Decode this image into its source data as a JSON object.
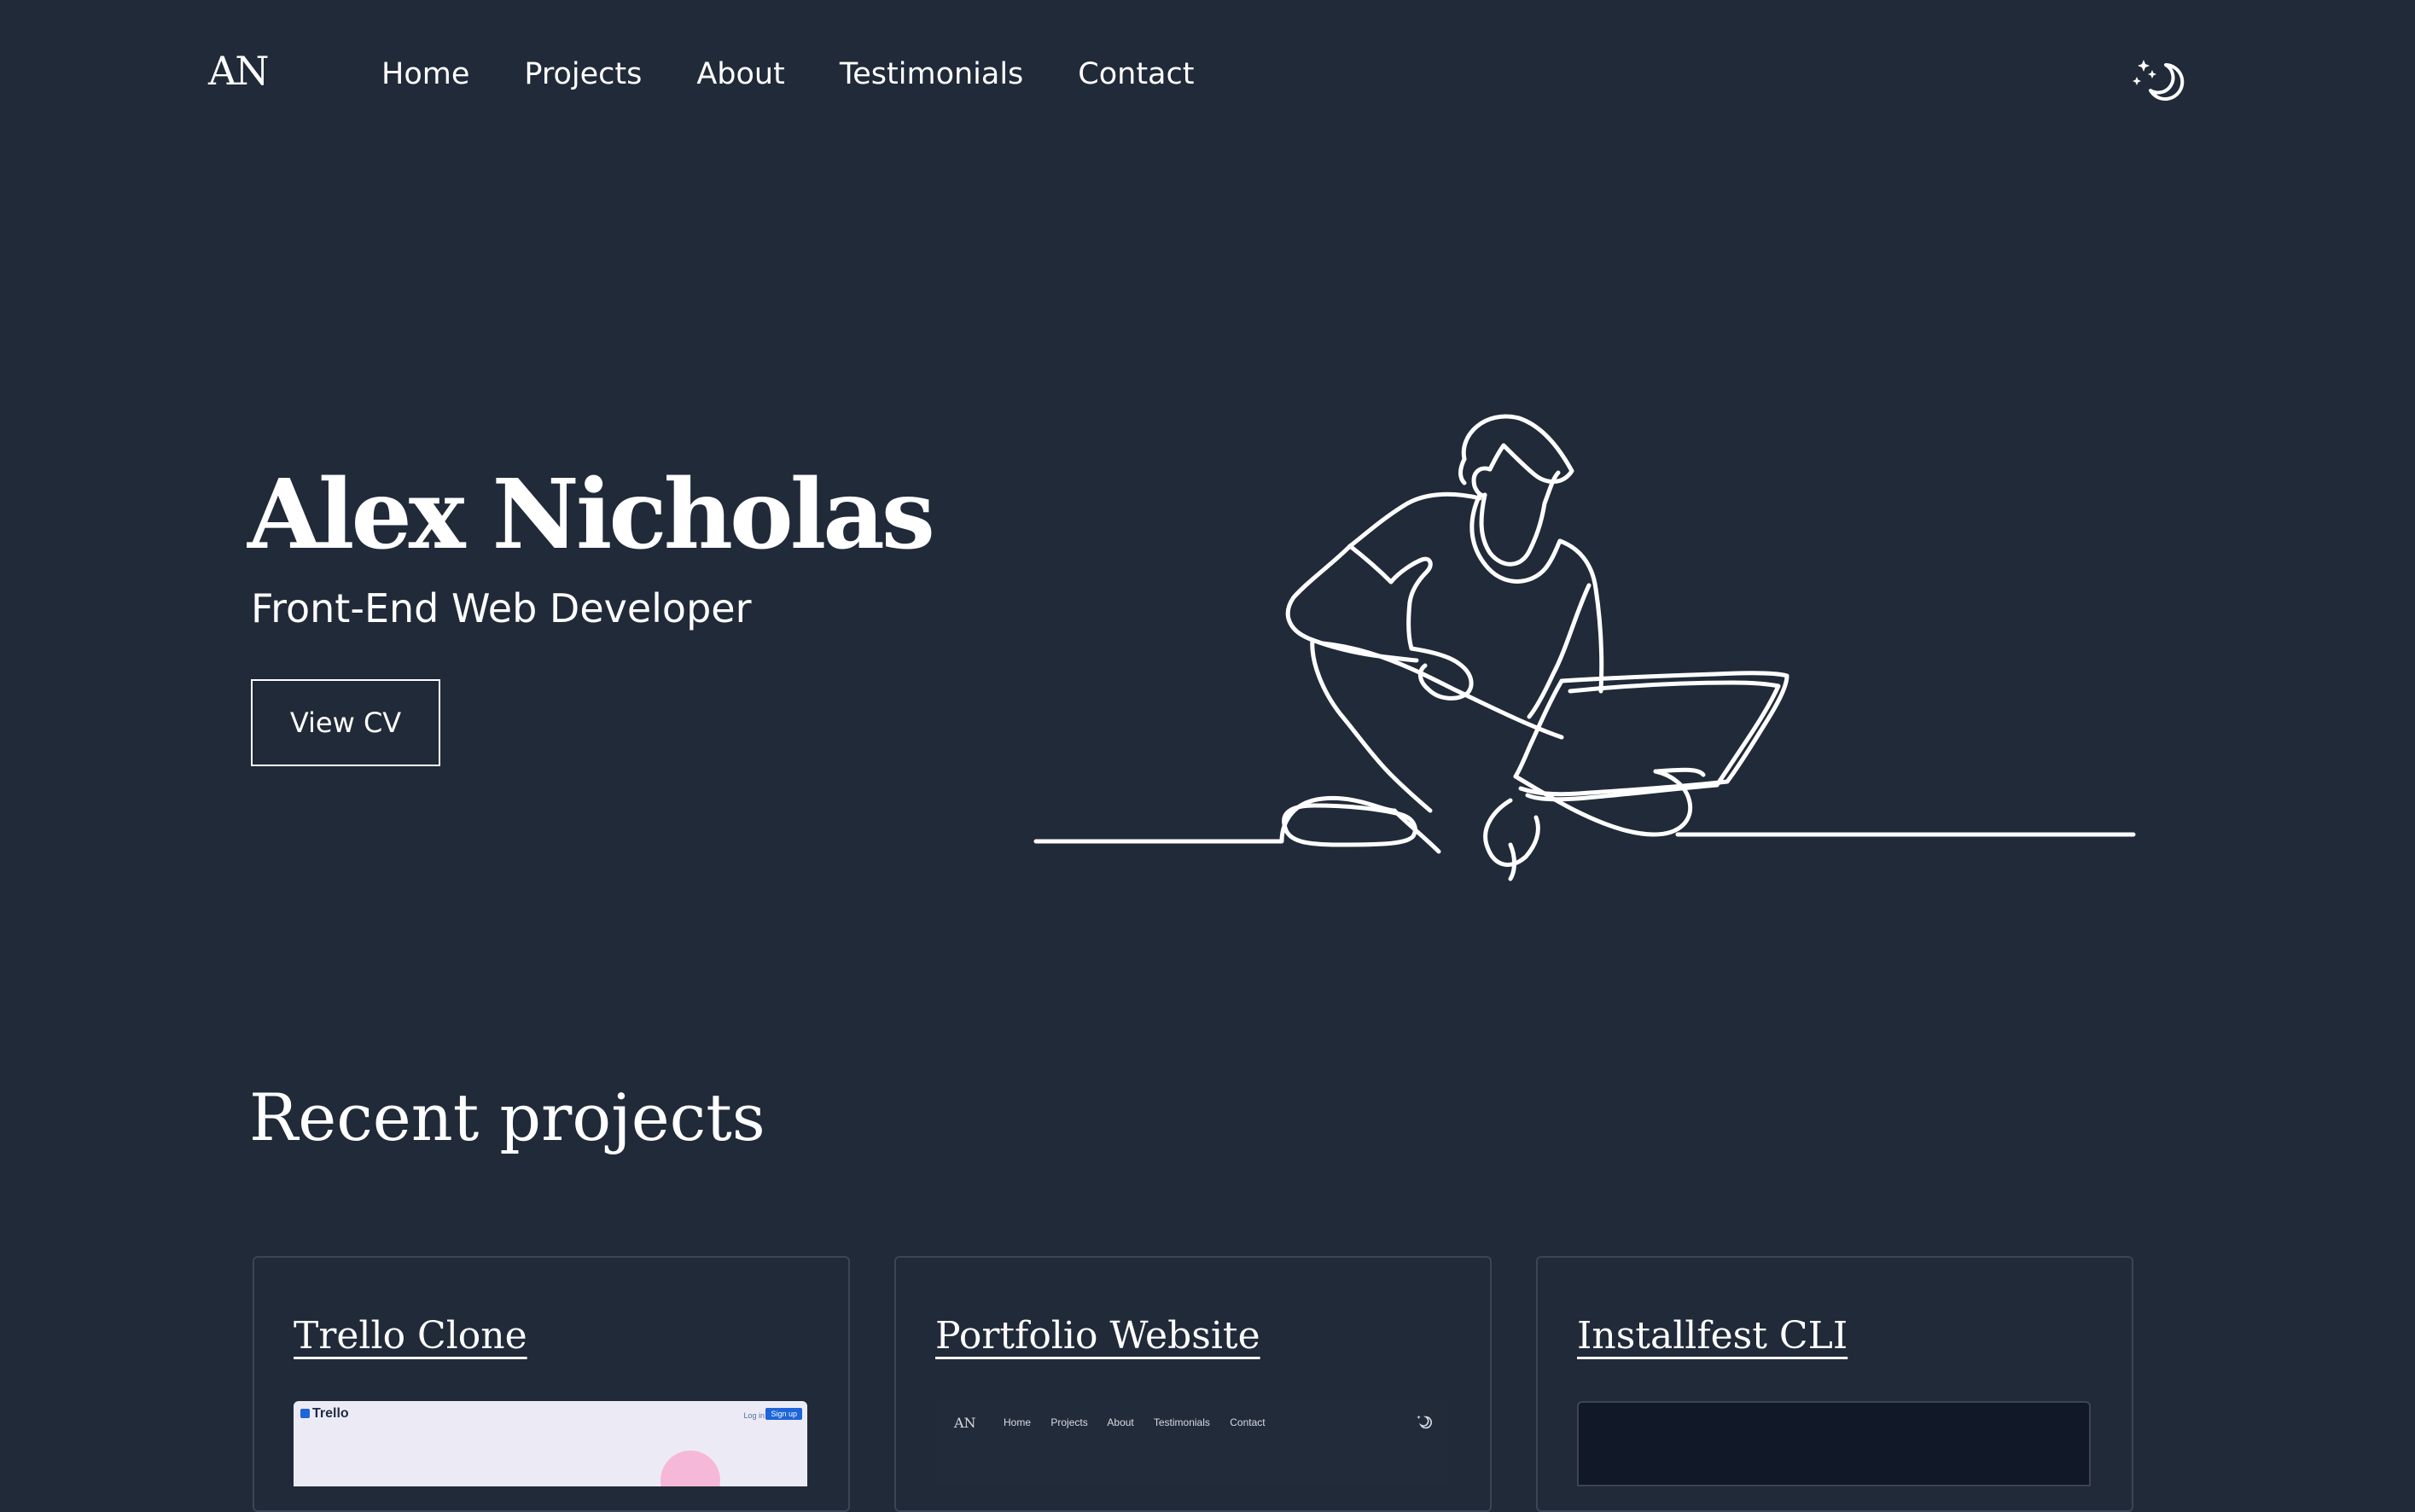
{
  "header": {
    "logo": "AN",
    "nav": [
      "Home",
      "Projects",
      "About",
      "Testimonials",
      "Contact"
    ],
    "theme_toggle_icon": "moon-stars-icon"
  },
  "hero": {
    "name": "Alex Nicholas",
    "role": "Front-End Web Developer",
    "cv_button": "View CV",
    "illustration": "line-art-person-with-laptop"
  },
  "projects": {
    "title": "Recent projects",
    "cards": [
      {
        "title": "Trello Clone",
        "thumb": {
          "logo": "Trello",
          "login": "Log in",
          "signup": "Sign up"
        }
      },
      {
        "title": "Portfolio Website",
        "thumb": {
          "logo": "AN",
          "nav": [
            "Home",
            "Projects",
            "About",
            "Testimonials",
            "Contact"
          ]
        }
      },
      {
        "title": "Installfest CLI"
      }
    ]
  },
  "colors": {
    "background": "#212a39",
    "text": "#ffffff",
    "card_border": "#3c4556"
  }
}
